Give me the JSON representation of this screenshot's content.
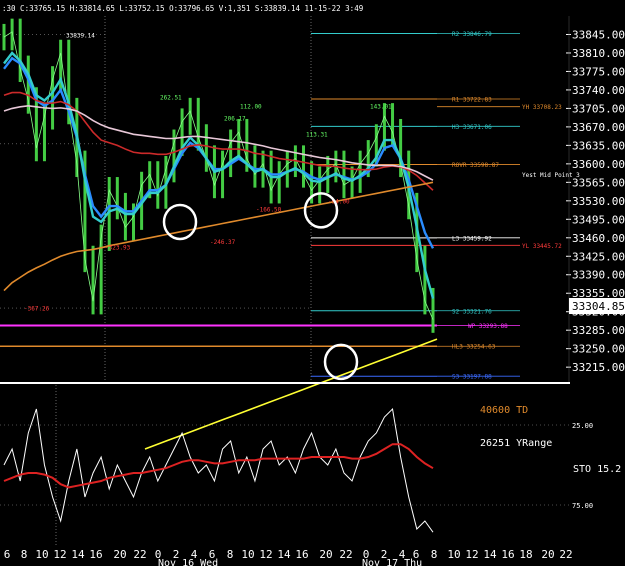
{
  "header": {
    "text": ":30 C:33765.15 H:33814.65 L:33752.15 O:33796.65 V:1,351 S:33839.14 11-15-22 3:49"
  },
  "chart_data": {
    "type": "line",
    "price_axis": {
      "ylim": [
        33185,
        33880
      ],
      "ticks": [
        33845,
        33810,
        33775,
        33740,
        33705,
        33670,
        33635,
        33600,
        33565,
        33530,
        33495,
        33460,
        33425,
        33390,
        33355,
        33320,
        33285,
        33250,
        33215
      ],
      "current_price": "33304.85"
    },
    "pivot_labels": [
      {
        "label": "R2 33846.79",
        "value": 33846.79,
        "color": "#33cccc"
      },
      {
        "label": "R1 33722.83",
        "value": 33722.83,
        "color": "#e08a2c"
      },
      {
        "label": "YH 33708.23",
        "value": 33708.23,
        "color": "#e08a2c"
      },
      {
        "label": "H3 33671.06",
        "value": 33671.06,
        "color": "#33cccc"
      },
      {
        "label": "ROVR 33598.87",
        "value": 33598.87,
        "color": "#e08a2c"
      },
      {
        "label": "Yest Mid Point 3",
        "value": 33580,
        "color": "#ffffff"
      },
      {
        "label": "L3 33459.92",
        "value": 33459.92,
        "color": "#ffffff"
      },
      {
        "label": "YL 33445.72",
        "value": 33445.72,
        "color": "#ff3b3b"
      },
      {
        "label": "S2 33321.76",
        "value": 33321.76,
        "color": "#33cccc"
      },
      {
        "label": "WP 33293.88",
        "value": 33293.88,
        "color": "#ff33ff"
      },
      {
        "label": "HL3 33254.63",
        "value": 33254.63,
        "color": "#e08a2c"
      },
      {
        "label": "S3 33197.88",
        "value": 33197.88,
        "color": "#3b6bff"
      }
    ],
    "annotations": [
      {
        "label": "33839.14",
        "value": 33839,
        "color": "#ffffff"
      },
      {
        "label": "262.51",
        "value": 33722,
        "color": "#66ff66"
      },
      {
        "label": "112.00",
        "value": 33705,
        "color": "#66ff66"
      },
      {
        "label": "206.17",
        "value": 33682,
        "color": "#66ff66"
      },
      {
        "label": "113.31",
        "value": 33652,
        "color": "#66ff66"
      },
      {
        "label": "143.01",
        "value": 33705,
        "color": "#66ff66"
      },
      {
        "label": "-166.50",
        "value": 33510,
        "color": "#ff3b3b"
      },
      {
        "label": "-246.37",
        "value": 33448,
        "color": "#ff3b3b"
      },
      {
        "label": "-323.93",
        "value": 33438,
        "color": "#ff3b3b"
      },
      {
        "label": "-367.26",
        "value": 33322,
        "color": "#ff3b3b"
      },
      {
        "label": "-94.00",
        "value": 33525,
        "color": "#ff3b3b"
      }
    ],
    "price_series": [
      33840,
      33850,
      33780,
      33720,
      33630,
      33690,
      33760,
      33810,
      33700,
      33600,
      33420,
      33340,
      33460,
      33550,
      33520,
      33480,
      33500,
      33560,
      33580,
      33540,
      33590,
      33640,
      33680,
      33700,
      33650,
      33610,
      33560,
      33600,
      33640,
      33660,
      33610,
      33580,
      33600,
      33550,
      33580,
      33600,
      33610,
      33580,
      33550,
      33570,
      33590,
      33600,
      33560,
      33570,
      33600,
      33620,
      33650,
      33690,
      33660,
      33600,
      33520,
      33420,
      33340,
      33305
    ],
    "ma_series": [
      {
        "color": "#2a8cff",
        "values": [
          33780,
          33800,
          33790,
          33760,
          33720,
          33710,
          33720,
          33740,
          33700,
          33650,
          33580,
          33520,
          33500,
          33520,
          33520,
          33510,
          33510,
          33530,
          33550,
          33550,
          33560,
          33590,
          33620,
          33640,
          33630,
          33610,
          33590,
          33590,
          33600,
          33610,
          33600,
          33590,
          33590,
          33580,
          33580,
          33585,
          33590,
          33585,
          33575,
          33570,
          33575,
          33580,
          33575,
          33570,
          33575,
          33585,
          33600,
          33630,
          33635,
          33610,
          33570,
          33520,
          33470,
          33440
        ]
      },
      {
        "color": "#33cccc",
        "values": [
          33790,
          33810,
          33795,
          33770,
          33730,
          33720,
          33735,
          33760,
          33715,
          33655,
          33570,
          33500,
          33490,
          33510,
          33515,
          33505,
          33505,
          33525,
          33545,
          33545,
          33560,
          33595,
          33630,
          33650,
          33635,
          33610,
          33585,
          33590,
          33605,
          33615,
          33600,
          33585,
          33590,
          33575,
          33575,
          33585,
          33592,
          33582,
          33568,
          33566,
          33574,
          33582,
          33572,
          33568,
          33578,
          33592,
          33612,
          33645,
          33645,
          33610,
          33555,
          33480,
          33400,
          33345
        ]
      },
      {
        "color": "#cc2a2a",
        "values": [
          33730,
          33735,
          33735,
          33730,
          33720,
          33715,
          33715,
          33718,
          33712,
          33700,
          33680,
          33660,
          33645,
          33640,
          33635,
          33628,
          33622,
          33620,
          33620,
          33618,
          33618,
          33622,
          33628,
          33634,
          33636,
          33634,
          33630,
          33628,
          33628,
          33628,
          33625,
          33620,
          33618,
          33614,
          33610,
          33608,
          33606,
          33603,
          33600,
          33597,
          33596,
          33595,
          33592,
          33590,
          33589,
          33589,
          33590,
          33594,
          33596,
          33594,
          33588,
          33578,
          33564,
          33550
        ]
      },
      {
        "color": "#e8c8d8",
        "values": [
          33700,
          33705,
          33708,
          33710,
          33708,
          33706,
          33705,
          33706,
          33704,
          33700,
          33692,
          33682,
          33674,
          33668,
          33664,
          33660,
          33656,
          33654,
          33652,
          33650,
          33648,
          33648,
          33650,
          33652,
          33652,
          33650,
          33648,
          33646,
          33644,
          33642,
          33640,
          33637,
          33634,
          33630,
          33627,
          33624,
          33621,
          33618,
          33615,
          33612,
          33610,
          33608,
          33605,
          33602,
          33600,
          33598,
          33597,
          33597,
          33597,
          33595,
          33591,
          33585,
          33577,
          33569
        ]
      },
      {
        "color": "#e08a2c",
        "values": [
          33360,
          33375,
          33385,
          33395,
          33403,
          33410,
          33418,
          33425,
          33430,
          33434,
          33436,
          33438,
          33441,
          33445,
          33448,
          33451,
          33454,
          33457,
          33460,
          33463,
          33466,
          33469,
          33472,
          33475,
          33478,
          33481,
          33484,
          33487,
          33490,
          33493,
          33496,
          33499,
          33502,
          33505,
          33508,
          33511,
          33514,
          33517,
          33520,
          33523,
          33526,
          33529,
          33532,
          33535,
          33538,
          33541,
          33544,
          33547,
          33550,
          33553,
          33556,
          33559,
          33562,
          33565
        ]
      },
      {
        "color": "#ffff33",
        "values": [
          33060,
          33068,
          33076,
          33084,
          33092,
          33100,
          33108,
          33116,
          33124,
          33132,
          33140,
          33148,
          33156,
          33164,
          33172,
          33180,
          33188,
          33196,
          33204,
          33212,
          33220,
          33228,
          33236,
          33244,
          33252,
          33260,
          33268
        ]
      }
    ],
    "indicator": {
      "label": "STO 15.2",
      "ylim": [
        100,
        0
      ],
      "ticks": [
        25,
        75
      ],
      "tick_labels": [
        "25.00",
        "75.00"
      ],
      "td_label": "40600 TD",
      "yrange_label": "26251 YRange",
      "stoch_values": [
        50,
        40,
        60,
        30,
        15,
        50,
        70,
        85,
        60,
        40,
        70,
        55,
        45,
        65,
        50,
        60,
        70,
        55,
        45,
        60,
        50,
        40,
        30,
        45,
        55,
        50,
        60,
        40,
        35,
        55,
        45,
        60,
        40,
        35,
        50,
        45,
        55,
        40,
        30,
        45,
        50,
        40,
        55,
        60,
        45,
        35,
        30,
        20,
        15,
        45,
        70,
        90,
        85,
        92
      ],
      "signal_values": [
        60,
        58,
        56,
        55,
        55,
        56,
        58,
        62,
        64,
        63,
        62,
        61,
        60,
        58,
        57,
        56,
        55,
        55,
        54,
        53,
        52,
        50,
        48,
        47,
        47,
        48,
        49,
        49,
        48,
        47,
        47,
        47,
        46,
        46,
        46,
        46,
        46,
        46,
        45,
        45,
        45,
        45,
        45,
        46,
        46,
        45,
        43,
        40,
        37,
        37,
        40,
        45,
        49,
        52
      ]
    },
    "x_ticks": [
      "6",
      "8",
      "10",
      "12",
      "14",
      "16",
      "20",
      "22",
      "0",
      "2",
      "4",
      "6",
      "8",
      "10",
      "12",
      "14",
      "16",
      "20",
      "22",
      "0",
      "2",
      "4",
      "6",
      "8",
      "10",
      "12",
      "14",
      "16",
      "18",
      "20",
      "22"
    ],
    "x_tick_positions": [
      7,
      24,
      42,
      60,
      78,
      96,
      120,
      140,
      158,
      176,
      194,
      212,
      230,
      248,
      266,
      284,
      302,
      326,
      346,
      366,
      384,
      402,
      416,
      434,
      454,
      472,
      490,
      508,
      526,
      548,
      566
    ],
    "date_labels": [
      "Nov 16 Wed",
      "Nov 17 Thu"
    ]
  }
}
